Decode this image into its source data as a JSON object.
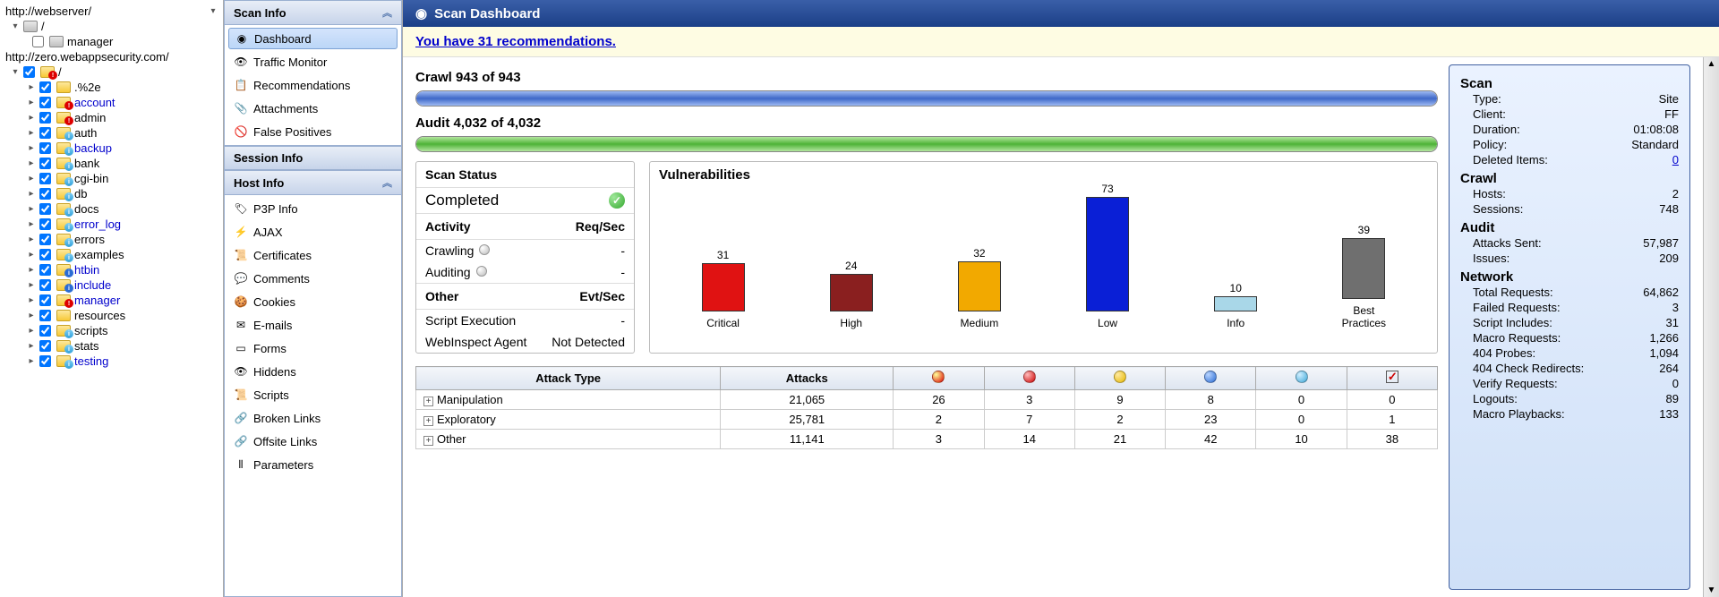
{
  "tree": {
    "host1": "http://webserver/",
    "host1_root": "/",
    "host1_items": [
      "manager"
    ],
    "host2": "http://zero.webappsecurity.com/",
    "host2_root": "/",
    "host2_items": [
      {
        "label": ".%2e",
        "link": false,
        "badge": null
      },
      {
        "label": "account",
        "link": true,
        "badge": "red"
      },
      {
        "label": "admin",
        "link": false,
        "badge": "red"
      },
      {
        "label": "auth",
        "link": false,
        "badge": "cyan"
      },
      {
        "label": "backup",
        "link": true,
        "badge": "cyan"
      },
      {
        "label": "bank",
        "link": false,
        "badge": "cyan"
      },
      {
        "label": "cgi-bin",
        "link": false,
        "badge": "cyan"
      },
      {
        "label": "db",
        "link": false,
        "badge": "cyan"
      },
      {
        "label": "docs",
        "link": false,
        "badge": "cyan"
      },
      {
        "label": "error_log",
        "link": true,
        "badge": "cyan"
      },
      {
        "label": "errors",
        "link": false,
        "badge": "cyan"
      },
      {
        "label": "examples",
        "link": false,
        "badge": "cyan"
      },
      {
        "label": "htbin",
        "link": true,
        "badge": "blue"
      },
      {
        "label": "include",
        "link": true,
        "badge": "blue"
      },
      {
        "label": "manager",
        "link": true,
        "badge": "red"
      },
      {
        "label": "resources",
        "link": false,
        "badge": null
      },
      {
        "label": "scripts",
        "link": false,
        "badge": "cyan"
      },
      {
        "label": "stats",
        "link": false,
        "badge": "cyan"
      },
      {
        "label": "testing",
        "link": true,
        "badge": "cyan"
      }
    ]
  },
  "mid": {
    "scan_info_hdr": "Scan Info",
    "scan_info_items": [
      "Dashboard",
      "Traffic Monitor",
      "Recommendations",
      "Attachments",
      "False Positives"
    ],
    "session_info_hdr": "Session Info",
    "host_info_hdr": "Host Info",
    "host_info_items": [
      "P3P Info",
      "AJAX",
      "Certificates",
      "Comments",
      "Cookies",
      "E-mails",
      "Forms",
      "Hiddens",
      "Scripts",
      "Broken Links",
      "Offsite Links",
      "Parameters"
    ]
  },
  "dash": {
    "title": "Scan Dashboard",
    "recs": "You have 31 recommendations.",
    "crawl_label": "Crawl  943 of 943",
    "audit_label": "Audit  4,032 of 4,032",
    "status": {
      "hdr": "Scan Status",
      "value": "Completed",
      "activity_hdr": "Activity",
      "reqsec_hdr": "Req/Sec",
      "crawling": "Crawling",
      "crawling_v": "-",
      "auditing": "Auditing",
      "auditing_v": "-",
      "other_hdr": "Other",
      "evtsec_hdr": "Evt/Sec",
      "script": "Script Execution",
      "script_v": "-",
      "agent": "WebInspect Agent",
      "agent_v": "Not Detected"
    },
    "vuln_title": "Vulnerabilities"
  },
  "chart_data": {
    "type": "bar",
    "title": "Vulnerabilities",
    "categories": [
      "Critical",
      "High",
      "Medium",
      "Low",
      "Info",
      "Best Practices"
    ],
    "values": [
      31,
      24,
      32,
      73,
      10,
      39
    ],
    "colors": [
      "#e01212",
      "#8a1f1f",
      "#f2a900",
      "#0a1fd6",
      "#a9d7e8",
      "#6f6f6f"
    ],
    "ylim": [
      0,
      80
    ]
  },
  "attack_table": {
    "headers": [
      "Attack Type",
      "Attacks",
      "crit",
      "high",
      "med",
      "low",
      "info",
      "bp"
    ],
    "headers_display": {
      "attack": "Attack Type",
      "attacks": "Attacks"
    },
    "rows": [
      {
        "name": "Manipulation",
        "attacks": "21,065",
        "crit": "26",
        "high": "3",
        "med": "9",
        "low": "8",
        "info": "0",
        "bp": "0"
      },
      {
        "name": "Exploratory",
        "attacks": "25,781",
        "crit": "2",
        "high": "7",
        "med": "2",
        "low": "23",
        "info": "0",
        "bp": "1"
      },
      {
        "name": "Other",
        "attacks": "11,141",
        "crit": "3",
        "high": "14",
        "med": "21",
        "low": "42",
        "info": "10",
        "bp": "38"
      }
    ]
  },
  "stats": {
    "scan_hdr": "Scan",
    "scan": [
      {
        "k": "Type:",
        "v": "Site"
      },
      {
        "k": "Client:",
        "v": "FF"
      },
      {
        "k": "Duration:",
        "v": "01:08:08"
      },
      {
        "k": "Policy:",
        "v": "Standard"
      },
      {
        "k": "Deleted Items:",
        "v": "0",
        "link": true
      }
    ],
    "crawl_hdr": "Crawl",
    "crawl": [
      {
        "k": "Hosts:",
        "v": "2"
      },
      {
        "k": "Sessions:",
        "v": "748"
      }
    ],
    "audit_hdr": "Audit",
    "audit": [
      {
        "k": "Attacks Sent:",
        "v": "57,987"
      },
      {
        "k": "Issues:",
        "v": "209"
      }
    ],
    "network_hdr": "Network",
    "network": [
      {
        "k": "Total Requests:",
        "v": "64,862"
      },
      {
        "k": "Failed Requests:",
        "v": "3"
      },
      {
        "k": "Script Includes:",
        "v": "31"
      },
      {
        "k": "Macro Requests:",
        "v": "1,266"
      },
      {
        "k": "404 Probes:",
        "v": "1,094"
      },
      {
        "k": "404 Check Redirects:",
        "v": "264"
      },
      {
        "k": "Verify Requests:",
        "v": "0"
      },
      {
        "k": "Logouts:",
        "v": "89"
      },
      {
        "k": "Macro Playbacks:",
        "v": "133"
      }
    ]
  }
}
